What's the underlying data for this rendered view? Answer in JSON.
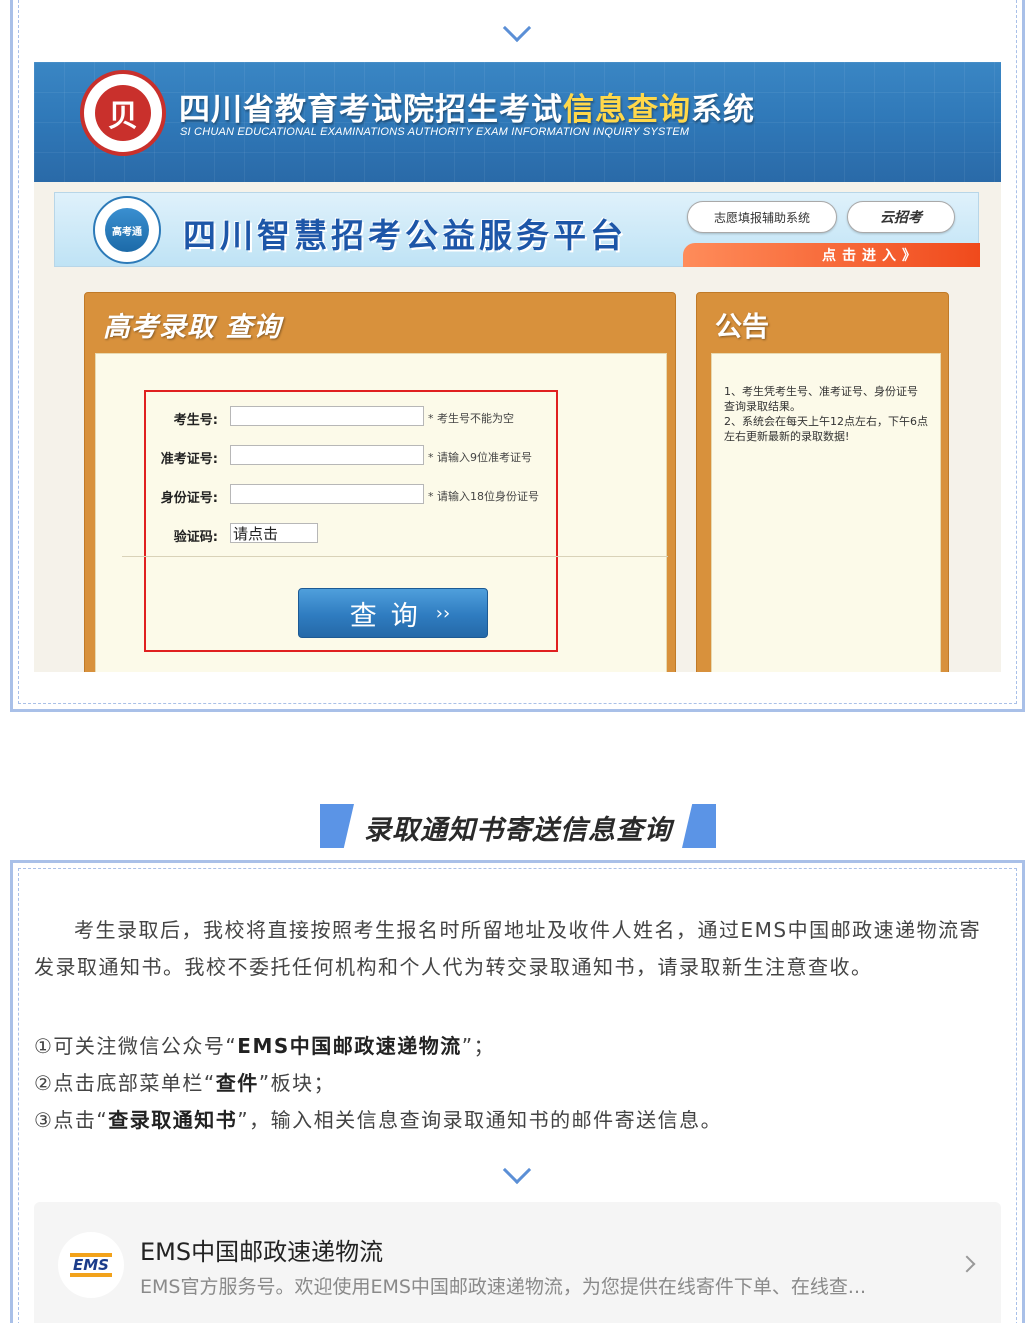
{
  "banner": {
    "seal_char": "贝",
    "title_prefix": "四川省教育考试院招生考试",
    "title_highlight": "信息查询",
    "title_suffix": "系统",
    "subtitle": "SI CHUAN EDUCATIONAL EXAMINATIONS AUTHORITY EXAM INFORMATION INQUIRY SYSTEM"
  },
  "platform": {
    "logo_text": "高考通",
    "title": "四川智慧招考公益服务平台",
    "link1": "志愿填报辅助系统",
    "link2": "云招考",
    "enter": "点击进入》"
  },
  "query": {
    "title": "高考录取 查询",
    "fields": [
      {
        "label": "考生号:",
        "hint": "* 考生号不能为空"
      },
      {
        "label": "准考证号:",
        "hint": "* 请输入9位准考证号"
      },
      {
        "label": "身份证号:",
        "hint": "* 请输入18位身份证号"
      }
    ],
    "captcha_label": "验证码:",
    "captcha_value": "请点击",
    "button_label": "查询",
    "button_arrow": "››"
  },
  "notice": {
    "title": "公告",
    "items": [
      "1、考生凭考生号、准考证号、身份证号查询录取结果。",
      "2、系统会在每天上午12点左右，下午6点左右更新最新的录取数据!"
    ]
  },
  "section2": {
    "heading": "录取通知书寄送信息查询",
    "paragraph": "考生录取后，我校将直接按照考生报名时所留地址及收件人姓名，通过EMS中国邮政速递物流寄发录取通知书。我校不委托任何机构和个人代为转交录取通知书，请录取新生注意查收。",
    "step1_prefix": "①可关注微信公众号“",
    "step1_bold": "EMS中国邮政速递物流",
    "step1_suffix": "”；",
    "step2_prefix": "②点击底部菜单栏“",
    "step2_bold": "查件",
    "step2_suffix": "”板块；",
    "step3_prefix": "③点击“",
    "step3_bold": "查录取通知书",
    "step3_suffix": "”，输入相关信息查询录取通知书的邮件寄送信息。"
  },
  "card": {
    "logo_text": "EMS",
    "name": "EMS中国邮政速递物流",
    "desc": "EMS官方服务号。欢迎使用EMS中国邮政速递物流，为您提供在线寄件下单、在线查..."
  },
  "colors": {
    "accent_blue": "#5b94e6",
    "frame": "#a9c0e8",
    "orange_panel": "#d8913c",
    "red_highlight": "#e02020"
  }
}
